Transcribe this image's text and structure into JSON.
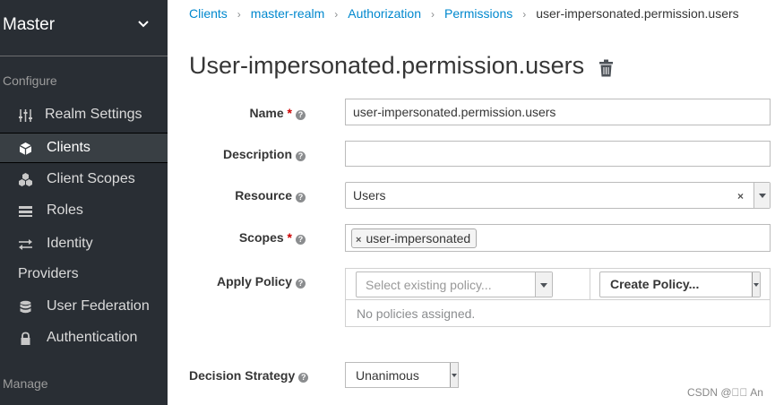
{
  "sidebar": {
    "realm": "Master",
    "configure_label": "Configure",
    "manage_label": "Manage",
    "items": [
      {
        "label": "Realm Settings",
        "icon": "sliders-icon"
      },
      {
        "label": "Clients",
        "icon": "cube-icon"
      },
      {
        "label": "Client Scopes",
        "icon": "cubes-icon"
      },
      {
        "label": "Roles",
        "icon": "list-icon"
      },
      {
        "label": "Identity",
        "label2": "Providers",
        "icon": "exchange-icon"
      },
      {
        "label": "User Federation",
        "icon": "database-icon"
      },
      {
        "label": "Authentication",
        "icon": "lock-icon"
      }
    ]
  },
  "breadcrumb": [
    "Clients",
    "master-realm",
    "Authorization",
    "Permissions",
    "user-impersonated.permission.users"
  ],
  "title": "User-impersonated.permission.users",
  "form": {
    "name_label": "Name",
    "name_value": "user-impersonated.permission.users",
    "description_label": "Description",
    "description_value": "",
    "resource_label": "Resource",
    "resource_value": "Users",
    "resource_clear": "×",
    "scopes_label": "Scopes",
    "scope_chip": "user-impersonated",
    "scope_chip_remove": "×",
    "apply_policy_label": "Apply Policy",
    "select_existing_placeholder": "Select existing policy...",
    "create_policy": "Create Policy...",
    "no_policies": "No policies assigned.",
    "decision_label": "Decision Strategy",
    "decision_value": "Unanimous",
    "required_mark": "*",
    "help_glyph": "?"
  },
  "watermark": "CSDN @\u0000\u0000 An",
  "colors": {
    "sidebar_bg": "#292e34",
    "active_bg": "#393f44",
    "link": "#0088ce",
    "required": "#cc0000"
  }
}
